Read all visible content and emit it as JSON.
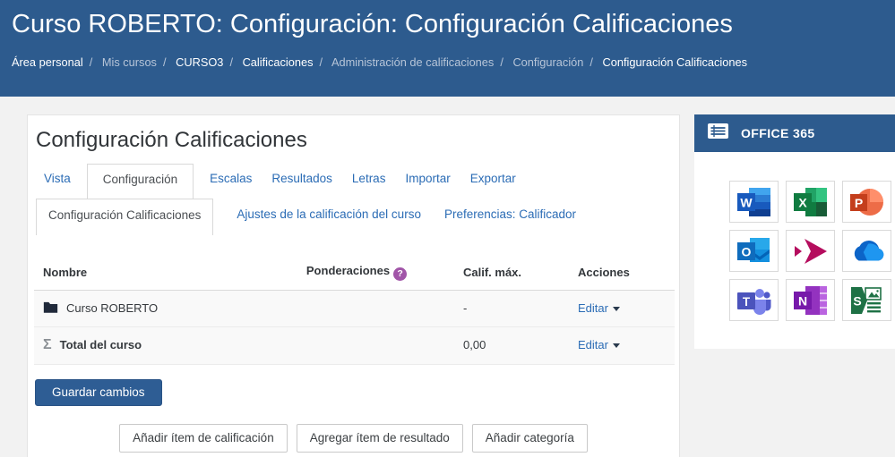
{
  "header": {
    "title": "Curso ROBERTO: Configuración: Configuración Calificaciones",
    "breadcrumb_separator": "/",
    "breadcrumb": [
      {
        "label": "Área personal"
      },
      {
        "label": "Mis cursos"
      },
      {
        "label": "CURSO3"
      },
      {
        "label": "Calificaciones"
      },
      {
        "label": "Administración de calificaciones"
      },
      {
        "label": "Configuración"
      },
      {
        "label": "Configuración Calificaciones"
      }
    ]
  },
  "main": {
    "heading": "Configuración Calificaciones",
    "tabs": [
      {
        "label": "Vista",
        "active": false
      },
      {
        "label": "Configuración",
        "active": true
      },
      {
        "label": "Escalas",
        "active": false
      },
      {
        "label": "Resultados",
        "active": false
      },
      {
        "label": "Letras",
        "active": false
      },
      {
        "label": "Importar",
        "active": false
      },
      {
        "label": "Exportar",
        "active": false
      }
    ],
    "subtabs": [
      {
        "label": "Configuración Calificaciones",
        "active": true
      },
      {
        "label": "Ajustes de la calificación del curso",
        "active": false
      },
      {
        "label": "Preferencias: Calificador",
        "active": false
      }
    ],
    "table": {
      "columns": {
        "name": "Nombre",
        "weights": "Ponderaciones",
        "max_grade": "Calif. máx.",
        "actions": "Acciones"
      },
      "help_glyph": "?",
      "sigma_glyph": "Σ",
      "rows": [
        {
          "icon": "folder-icon",
          "name": "Curso ROBERTO",
          "weight": "",
          "max_grade": "-",
          "action_label": "Editar"
        },
        {
          "icon": "sigma-icon",
          "name": "Total del curso",
          "weight": "",
          "max_grade": "0,00",
          "action_label": "Editar"
        }
      ]
    },
    "save_button_label": "Guardar cambios",
    "footer_buttons": [
      {
        "label": "Añadir ítem de calificación"
      },
      {
        "label": "Agregar ítem de resultado"
      },
      {
        "label": "Añadir categoría"
      }
    ]
  },
  "sidebar": {
    "block_title": "OFFICE 365",
    "apps": [
      {
        "name": "word"
      },
      {
        "name": "excel"
      },
      {
        "name": "powerpoint"
      },
      {
        "name": "outlook"
      },
      {
        "name": "powerapps"
      },
      {
        "name": "onedrive"
      },
      {
        "name": "teams"
      },
      {
        "name": "onenote"
      },
      {
        "name": "sway"
      }
    ]
  },
  "colors": {
    "header_bg": "#2d5b8e",
    "link_blue": "#2b6cb5",
    "button_blue": "#2e5d94",
    "help_purple": "#a155a8",
    "page_bg": "#f2f2f2",
    "row_bg": "#f9f9f9"
  }
}
